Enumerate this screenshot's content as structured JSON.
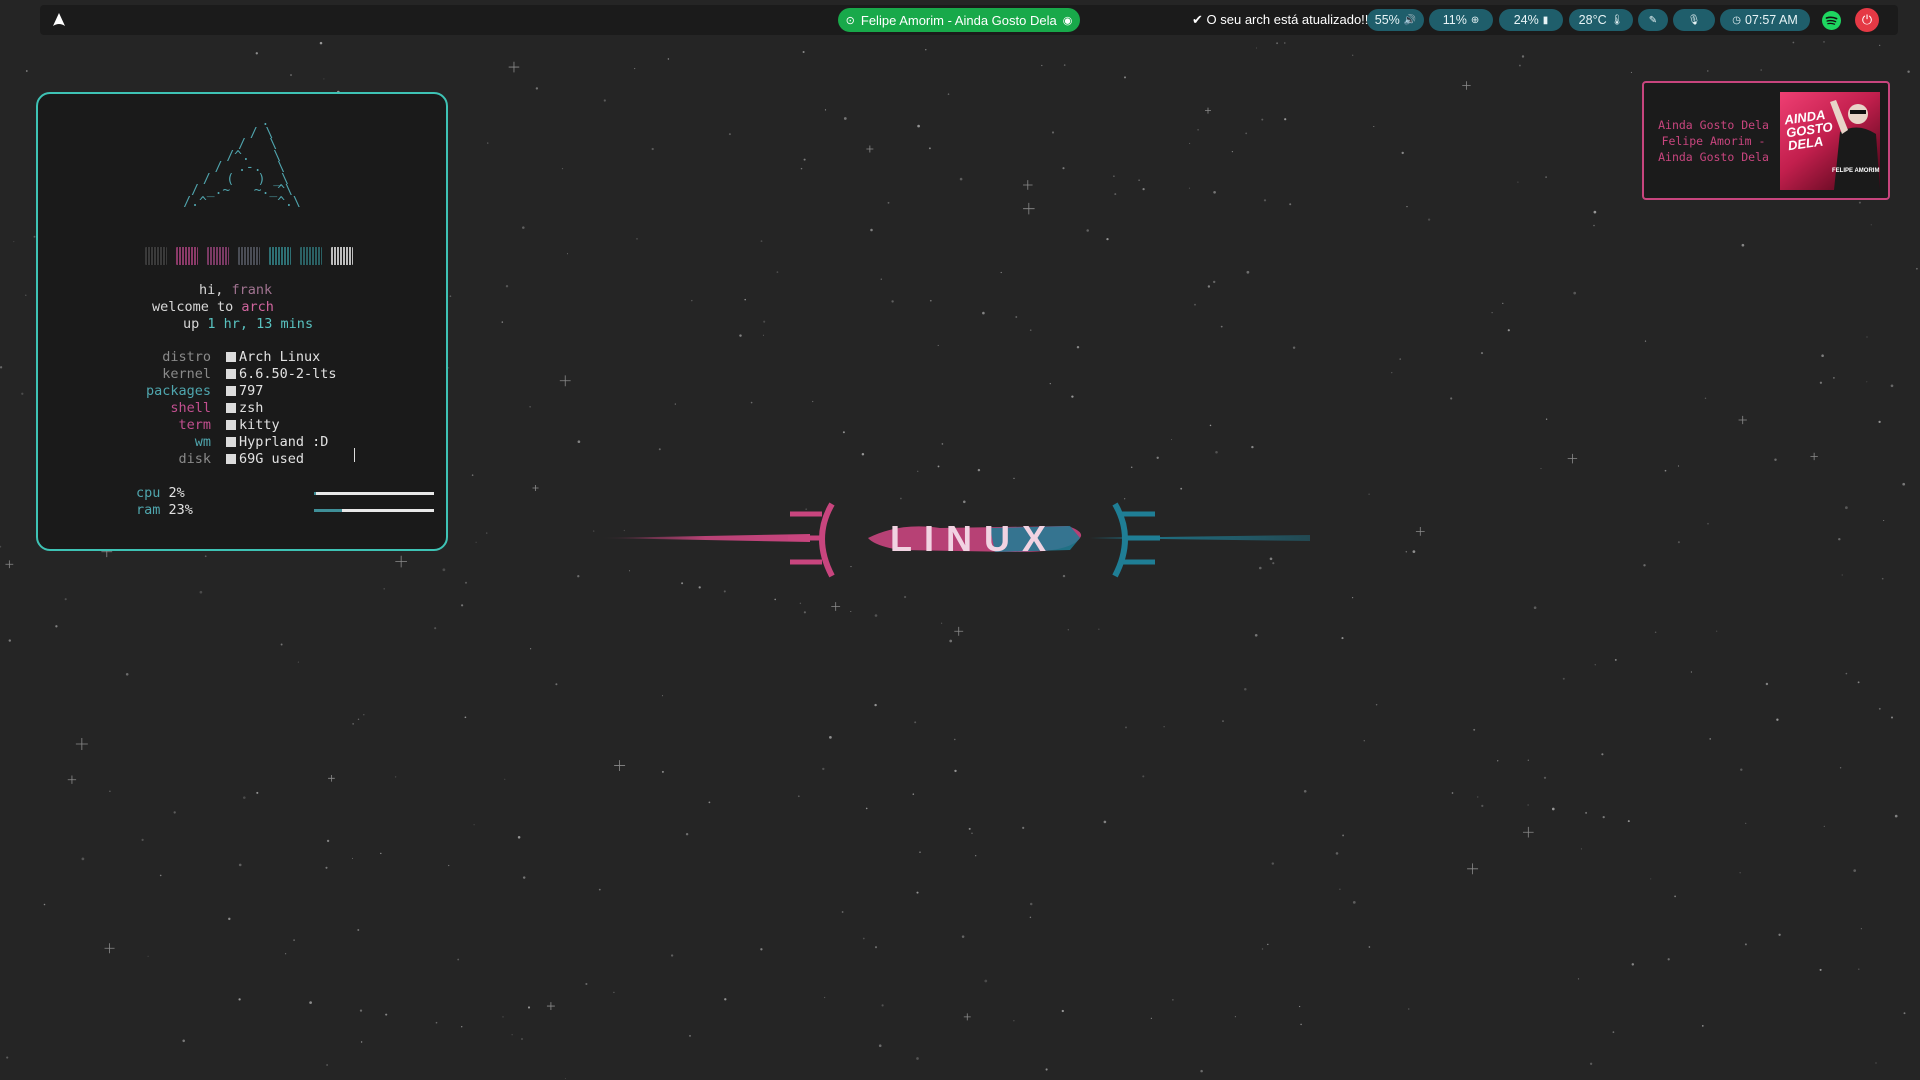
{
  "topbar": {
    "launcher_icon": "arch-logo-icon",
    "media": {
      "icon": "play-circle-icon",
      "label": "Felipe Amorim - Ainda Gosto Dela",
      "app_icon": "spotify-icon"
    },
    "update_status": {
      "icon": "check-icon",
      "label": "O seu arch está atualizado!!!"
    },
    "volume": {
      "label": "55%",
      "icon": "volume-icon"
    },
    "cpu": {
      "label": "11%",
      "icon": "cpu-icon"
    },
    "battery": {
      "label": "24%",
      "icon": "battery-icon"
    },
    "temperature": {
      "label": "28°C",
      "icon": "thermometer-icon"
    },
    "color_picker_icon": "pipette-icon",
    "mic_icon": "mic-off-icon",
    "clock": {
      "icon": "clock-icon",
      "label": "07:57 AM"
    },
    "spotify_icon": "spotify-icon",
    "power_icon": "power-icon"
  },
  "fetch": {
    "greeting_hi": "hi,",
    "user": "frank",
    "welcome": "welcome to",
    "distro_short": "arch",
    "up_label": "up",
    "uptime": "1 hr, 13 mins",
    "info": [
      {
        "key": "distro",
        "value": "Arch Linux"
      },
      {
        "key": "kernel",
        "value": "6.6.50-2-lts"
      },
      {
        "key": "packages",
        "value": "797"
      },
      {
        "key": "shell",
        "value": "zsh"
      },
      {
        "key": "term",
        "value": "kitty"
      },
      {
        "key": "wm",
        "value": "Hyprland :D"
      },
      {
        "key": "disk",
        "value": "69G used"
      }
    ],
    "cpu": {
      "label": "cpu",
      "value": "2%",
      "fraction": 0.02
    },
    "ram": {
      "label": "ram",
      "value": "23%",
      "fraction": 0.23
    },
    "swatch_colors": [
      "#3a3a3a",
      "#8a3a68",
      "#7a3a64",
      "#4a4d55",
      "#2e6f73",
      "#2b6063",
      "#bdbdbd"
    ]
  },
  "wallpaper": {
    "logo_text": "LINUX"
  },
  "now_playing": {
    "title": "Ainda Gosto Dela",
    "line2": "Felipe Amorim -",
    "line3": "Ainda Gosto Dela",
    "cover_title": "AINDA GOSTO DELA",
    "cover_artist": "FELIPE AMORIM"
  },
  "colors": {
    "accent_cyan": "#3ec3b5",
    "accent_pink": "#c8457e",
    "bar_pill": "#1f5e6b",
    "media_green": "#18a94a",
    "power_red": "#e53945"
  }
}
